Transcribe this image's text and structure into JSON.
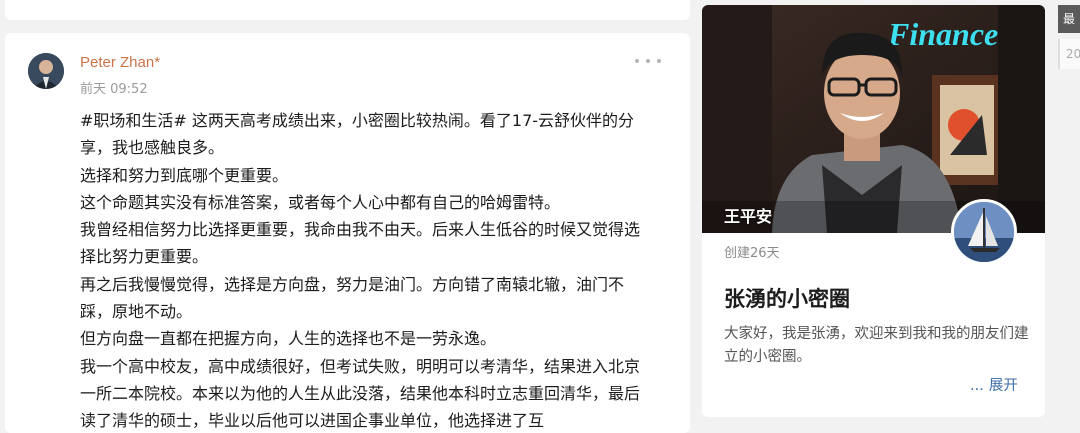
{
  "post": {
    "author": "Peter Zhan*",
    "time": "前天 09:52",
    "paragraphs": [
      "#职场和生活# 这两天高考成绩出来，小密圈比较热闹。看了17-云舒伙伴的分享，我也感触良多。",
      "选择和努力到底哪个更重要。",
      "这个命题其实没有标准答案，或者每个人心中都有自己的哈姆雷特。",
      "我曾经相信努力比选择更重要，我命由我不由天。后来人生低谷的时候又觉得选择比努力更重要。",
      "再之后我慢慢觉得，选择是方向盘，努力是油门。方向错了南辕北辙，油门不踩，原地不动。",
      "但方向盘一直都在把握方向，人生的选择也不是一劳永逸。",
      "我一个高中校友，高中成绩很好，但考试失败，明明可以考清华，结果进入北京一所二本院校。本来以为他的人生从此没落，结果他本科时立志重回清华，最后读了清华的硕士，毕业以后他可以进国企事业单位，他选择进了互"
    ]
  },
  "group": {
    "cover_label": "王平安",
    "cover_sign": "Finance",
    "created": "创建26天",
    "title": "张湧的小密圈",
    "description": "大家好，我是张湧，欢迎来到我和我的朋友们建立的小密圈。",
    "expand_dots": "...",
    "expand_label": "展开"
  },
  "side": {
    "tab1": "最",
    "tab2": "20"
  },
  "colors": {
    "author": "#c8754b",
    "link": "#3d6ea8",
    "sign": "#3de0f0"
  }
}
